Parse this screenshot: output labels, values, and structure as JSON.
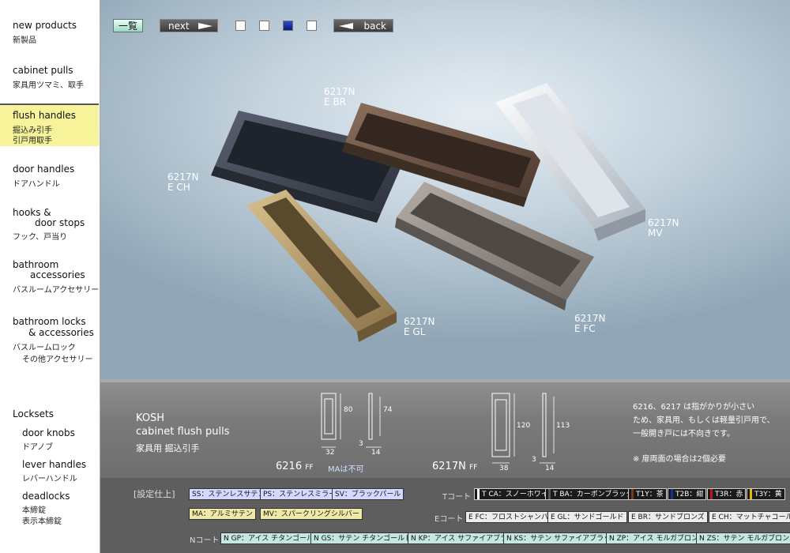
{
  "sidebar": {
    "items": [
      {
        "en": "new products",
        "jp": "新製品"
      },
      {
        "en": "cabinet pulls",
        "jp": "家具用ツマミ、取手"
      },
      {
        "en": "flush handles",
        "jp": "掘込み引手",
        "jp2": "引戸用取手"
      },
      {
        "en": "door handles",
        "jp": "ドアハンドル"
      },
      {
        "en": "hooks &",
        "en2": "door stops",
        "jp": "フック、戸当り"
      },
      {
        "en": "bathroom",
        "en2": "accessories",
        "jp": "バスルームアクセサリー"
      },
      {
        "en": "bathroom locks",
        "en2": "& accessories",
        "jp": "バスルームロック",
        "jp2": "その他アクセサリー"
      },
      {
        "en": "Locksets"
      },
      {
        "en": "door knobs",
        "jp": "ドアノブ"
      },
      {
        "en": "lever handles",
        "jp": "レバーハンドル"
      },
      {
        "en": "deadlocks",
        "jp": "本締錠",
        "jp2": "表示本締錠"
      }
    ]
  },
  "toolbar": {
    "list_label": "一覧",
    "next_label": "next",
    "back_label": "back",
    "page_count": 4,
    "selected_page": 3
  },
  "photo_labels": [
    {
      "model": "6217N",
      "finish": "E BR"
    },
    {
      "model": "6217N",
      "finish": "E CH"
    },
    {
      "model": "6217N",
      "finish": "MV"
    },
    {
      "model": "6217N",
      "finish": "E GL"
    },
    {
      "model": "6217N",
      "finish": "E FC"
    }
  ],
  "colors": {
    "ECH": "#3c4250",
    "EBR": "#6e5444",
    "MV": "#e8ecf0",
    "EGL": "#b49a6a",
    "EFC": "#8d8680"
  },
  "product": {
    "brand": "KOSH",
    "name_en": "cabinet flush pulls",
    "name_jp": "家具用 掘込引手"
  },
  "drawings": {
    "d6216": {
      "model": "6216",
      "suffix": "FF",
      "note": "MAは不可",
      "h": "80",
      "h2": "74",
      "w": "32",
      "t1": "3",
      "t2": "14"
    },
    "d6217": {
      "model": "6217N",
      "suffix": "FF",
      "h": "120",
      "h2": "113",
      "w": "38",
      "t1": "3",
      "t2": "14"
    }
  },
  "notes": {
    "line1": "6216、6217 は指がかりが小さい",
    "line2": "ため、家具用、もしくは軽量引戸用で、",
    "line3": "一般開き戸には不向きです。",
    "line4": "※ 扉両面の場合は2個必要"
  },
  "finishes": {
    "group_label": "[設定仕上]",
    "base": [
      {
        "label": "SS：ステンレスサテン"
      },
      {
        "label": "PS：ステンレスミラー"
      },
      {
        "label": "SV：ブラックパール"
      },
      {
        "label": "MA：アルミサテン"
      },
      {
        "label": "MV：スパークリングシルバー"
      }
    ],
    "t_label": "Tコート",
    "t": [
      {
        "label": "T CA：スノーホワイト",
        "chip": "#ffffff"
      },
      {
        "label": "T BA：カーボンブラック",
        "chip": "#222222"
      },
      {
        "label": "T1Y：茶",
        "chip": "#7b3a12"
      },
      {
        "label": "T2B：紺",
        "chip": "#1d2f8a"
      },
      {
        "label": "T3R：赤",
        "chip": "#c0141c"
      },
      {
        "label": "T3Y：黄",
        "chip": "#e6b800"
      }
    ],
    "e_label": "Eコート",
    "e": [
      {
        "label": "E FC：フロストシャンパン"
      },
      {
        "label": "E GL：サンドゴールド"
      },
      {
        "label": "E BR：サンドブロンズ"
      },
      {
        "label": "E CH：マットチャコール"
      }
    ],
    "n_label": "Nコート",
    "n": [
      {
        "label": "N GP：アイス チタンゴールド"
      },
      {
        "label": "N GS：サテン チタンゴールド"
      },
      {
        "label": "N KP：アイス サファイアブラック"
      },
      {
        "label": "N KS：サテン サファイアブラック"
      },
      {
        "label": "N ZP：アイス モルガブロンズ"
      },
      {
        "label": "N ZS：サテン モルガブロンズ"
      }
    ]
  }
}
